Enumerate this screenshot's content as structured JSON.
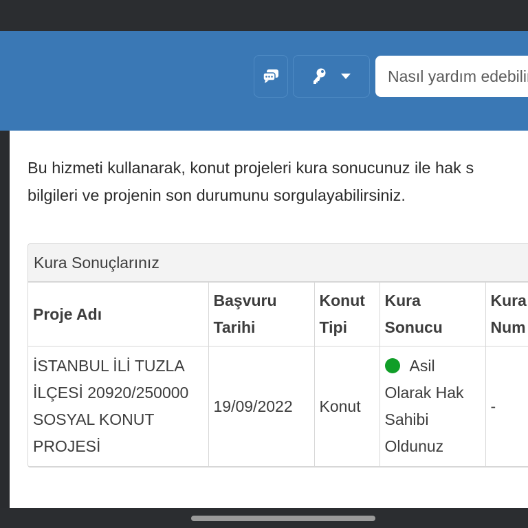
{
  "header": {
    "search_placeholder": "Nasıl yardım edebilirim?",
    "chat_icon": "chat-bubbles-icon",
    "key_icon": "key-icon",
    "caret_icon": "caret-down-icon",
    "brand_color": "#3a78b5"
  },
  "intro": {
    "line1": "Bu hizmeti kullanarak, konut projeleri kura sonucunuz ile hak s",
    "line2": "bilgileri ve projenin son durumunu sorgulayabilirsiniz."
  },
  "card": {
    "title": "Kura Sonuçlarınız",
    "columns": {
      "project": [
        "Proje Adı"
      ],
      "date": [
        "Başvuru",
        "Tarihi"
      ],
      "type": [
        "Konut",
        "Tipi"
      ],
      "result": [
        "Kura",
        "Sonucu"
      ],
      "number": [
        "Kura",
        "Num"
      ]
    },
    "row": {
      "project": [
        "İSTANBUL İLİ TUZLA",
        "İLÇESİ 20920/250000",
        "SOSYAL KONUT",
        "PROJESİ"
      ],
      "date": "19/09/2022",
      "type": "Konut",
      "result": [
        "Asil",
        "Olarak Hak",
        "Sahibi",
        "Oldunuz"
      ],
      "result_status_color": "#109e28",
      "number": "-"
    }
  }
}
